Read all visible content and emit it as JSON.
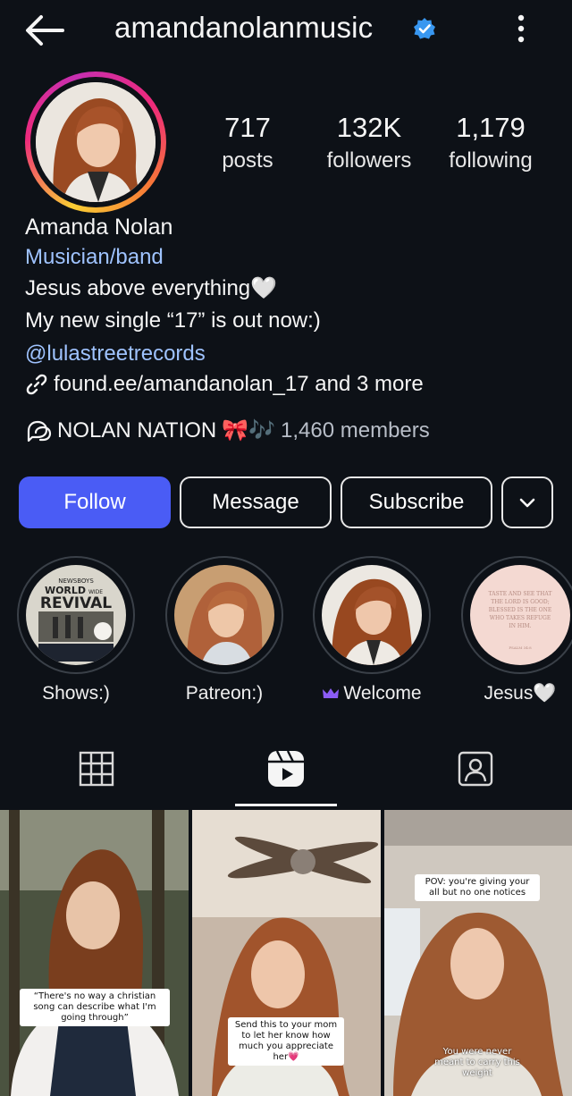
{
  "header": {
    "username": "amandanolanmusic",
    "verified": true,
    "icons": [
      "back-arrow-icon",
      "verified-badge-icon",
      "more-vertical-icon"
    ]
  },
  "stats": {
    "posts_value": "717",
    "posts_label": "posts",
    "followers_value": "132K",
    "followers_label": "followers",
    "following_value": "1,179",
    "following_label": "following"
  },
  "bio": {
    "name": "Amanda Nolan",
    "category": "Musician/band",
    "line1": "Jesus above everything",
    "line1_emoji": "🤍",
    "line2": "My new single “17” is out now:)",
    "mention": "@lulastreetrecords",
    "link": "found.ee/amandanolan_17 and 3 more",
    "channel_name": "NOLAN NATION",
    "channel_emojis": "🎀🎶",
    "channel_members": "1,460 members"
  },
  "actions": {
    "follow": "Follow",
    "message": "Message",
    "subscribe": "Subscribe"
  },
  "highlights": [
    {
      "label": "Shows:)"
    },
    {
      "label": "Patreon:)"
    },
    {
      "label": "Welcome"
    },
    {
      "label": "Jesus🤍"
    }
  ],
  "highlight_art": {
    "poster_top": "NEWSBOYS",
    "poster_title_a": "WORLD",
    "poster_title_b": "WIDE",
    "poster_title_c": "REVIVAL",
    "verse": "TASTE AND SEE THAT THE LORD IS GOOD; BLESSED IS THE ONE WHO TAKES REFUGE IN HIM.",
    "verse_ref": "PSALM 34:8"
  },
  "tabs": [
    {
      "name": "posts-grid",
      "icon": "grid-icon",
      "active": false
    },
    {
      "name": "reels",
      "icon": "reels-icon",
      "active": true
    },
    {
      "name": "tagged",
      "icon": "tagged-user-icon",
      "active": false
    }
  ],
  "reels": [
    {
      "caption": "“There's no way a christian song can describe what I'm going through”"
    },
    {
      "caption": "Send this to your mom to let her know how much you appreciate her💗"
    },
    {
      "caption_top": "POV: you're giving your all but no one notices",
      "caption_bottom": "You were never meant to carry this weight"
    }
  ],
  "colors": {
    "background": "#0d1117",
    "follow_button": "#4a5cf5",
    "link_blue": "#9fc3ff",
    "verified_blue": "#3897f0"
  }
}
